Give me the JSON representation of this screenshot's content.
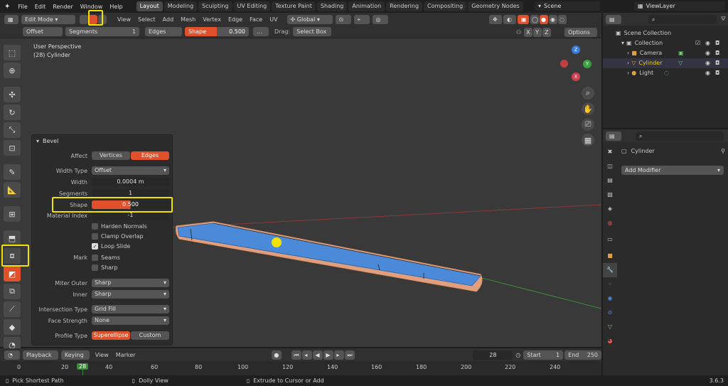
{
  "menubar": {
    "items": [
      "File",
      "Edit",
      "Render",
      "Window",
      "Help"
    ]
  },
  "workspaces": [
    "Layout",
    "Modeling",
    "Sculpting",
    "UV Editing",
    "Texture Paint",
    "Shading",
    "Animation",
    "Rendering",
    "Compositing",
    "Geometry Nodes"
  ],
  "active_workspace": "Layout",
  "scene_label": "Scene",
  "viewlayer_label": "ViewLayer",
  "header": {
    "mode": "Edit Mode",
    "menu": [
      "View",
      "Select",
      "Add",
      "Mesh",
      "Vertex",
      "Edge",
      "Face",
      "UV"
    ],
    "transform_orientation": "Global"
  },
  "tool_settings": {
    "offset_type": "Offset",
    "segments_label": "Segments",
    "segments_value": "1",
    "affect": "Edges",
    "shape_label": "Shape",
    "shape_value": "0.500",
    "dots": "...",
    "drag_label": "Drag:",
    "drag_value": "Select Box",
    "options": "Options",
    "axes": [
      "X",
      "Y",
      "Z"
    ]
  },
  "viewport": {
    "line1": "User Perspective",
    "line2": "(28) Cylinder",
    "gizmo": {
      "z": "Z",
      "y": "Y",
      "x": "X"
    }
  },
  "bevel_panel": {
    "title": "Bevel",
    "affect_label": "Affect",
    "affect_options": [
      "Vertices",
      "Edges"
    ],
    "width_type_label": "Width Type",
    "width_type_value": "Offset",
    "width_label": "Width",
    "width_value": "0.0004 m",
    "segments_label": "Segments",
    "segments_value": "1",
    "shape_label": "Shape",
    "shape_value": "0.500",
    "material_index_label": "Material Index",
    "material_index_value": "-1",
    "harden_normals": "Harden Normals",
    "clamp_overlap": "Clamp Overlap",
    "loop_slide": "Loop Slide",
    "mark_label": "Mark",
    "seams": "Seams",
    "sharp": "Sharp",
    "miter_outer_label": "Miter Outer",
    "miter_outer_value": "Sharp",
    "inner_label": "Inner",
    "inner_value": "Sharp",
    "intersection_type_label": "Intersection Type",
    "intersection_type_value": "Grid Fill",
    "face_strength_label": "Face Strength",
    "face_strength_value": "None",
    "profile_type_label": "Profile Type",
    "profile_options": [
      "Superellipse",
      "Custom"
    ]
  },
  "outliner": {
    "root": "Scene Collection",
    "collection": "Collection",
    "items": [
      "Camera",
      "Cylinder",
      "Light"
    ]
  },
  "properties": {
    "object_name": "Cylinder",
    "add_modifier": "Add Modifier"
  },
  "timeline": {
    "playback": "Playback",
    "keying": "Keying",
    "view": "View",
    "marker": "Marker",
    "current_frame": "28",
    "start_label": "Start",
    "start_value": "1",
    "end_label": "End",
    "end_value": "250",
    "ruler": [
      "0",
      "20",
      "28",
      "40",
      "60",
      "80",
      "100",
      "120",
      "140",
      "160",
      "180",
      "200",
      "220",
      "240"
    ]
  },
  "status": {
    "left": "Pick Shortest Path",
    "mid": "Dolly View",
    "right": "Extrude to Cursor or Add",
    "version": "3.6.3"
  },
  "colors": {
    "accent": "#e0502a",
    "highlight": "#f2e200",
    "mesh_face": "#4a8ad8",
    "selected_text": "#f0d000"
  }
}
